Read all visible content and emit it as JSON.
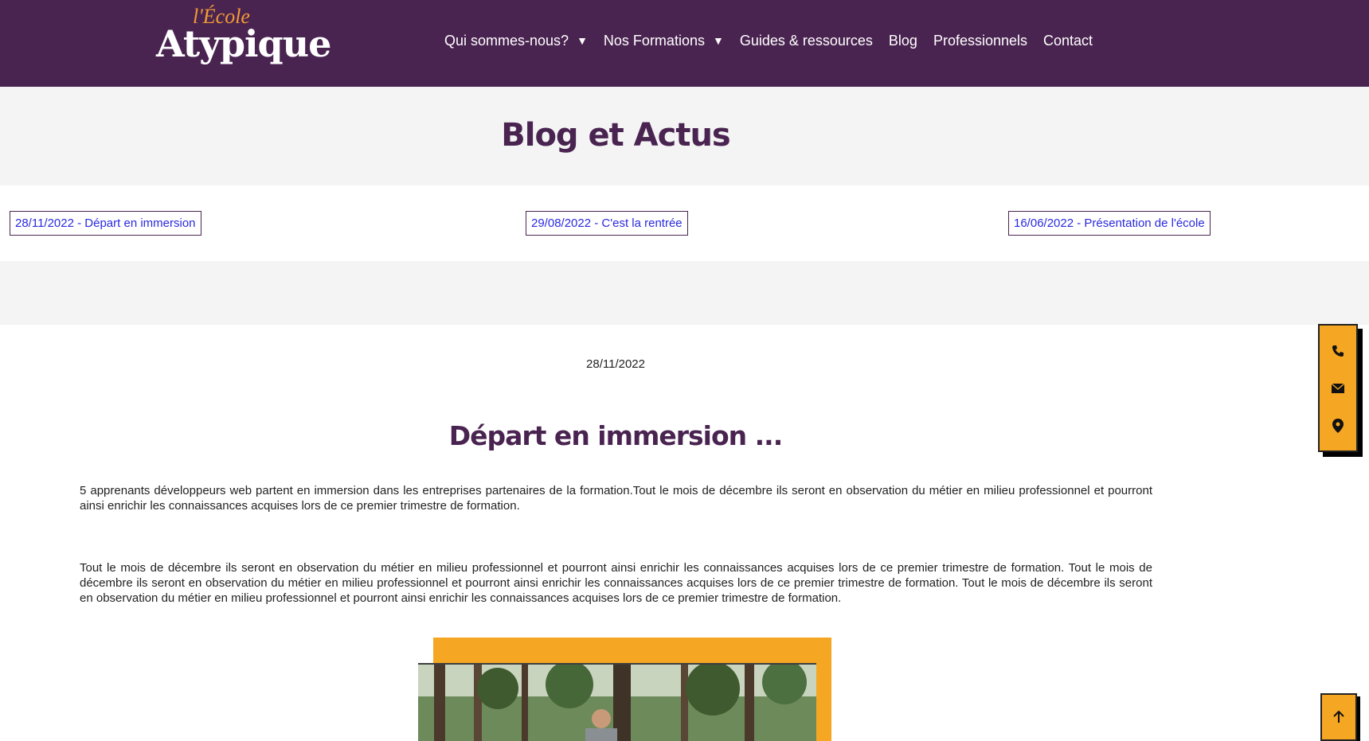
{
  "brand": {
    "logo_top": "l'École",
    "logo_main": "Atypique"
  },
  "nav": {
    "items": [
      {
        "label": "Qui sommes-nous?",
        "has_dropdown": true
      },
      {
        "label": "Nos Formations",
        "has_dropdown": true
      },
      {
        "label": "Guides & ressources",
        "has_dropdown": false
      },
      {
        "label": "Blog",
        "has_dropdown": false
      },
      {
        "label": "Professionnels",
        "has_dropdown": false
      },
      {
        "label": "Contact",
        "has_dropdown": false
      }
    ],
    "caret": "▼"
  },
  "page": {
    "title": "Blog et Actus"
  },
  "posts": [
    {
      "label": "28/11/2022 - Départ en immersion"
    },
    {
      "label": "29/08/2022 - C'est la rentrée"
    },
    {
      "label": "16/06/2022 - Présentation de l'école"
    }
  ],
  "article": {
    "date": "28/11/2022",
    "title": "Départ en immersion ...",
    "paragraph1": "5 apprenants développeurs web partent en immersion dans les entreprises partenaires de la formation.Tout le mois de décembre ils seront en observation du métier en milieu professionnel et pourront ainsi enrichir les connaissances acquises lors de ce premier trimestre de formation.",
    "paragraph2": "Tout le mois de décembre ils seront en observation du métier en milieu professionnel et pourront ainsi enrichir les connaissances acquises lors de ce premier trimestre de formation. Tout le mois de décembre ils seront en observation du métier en milieu professionnel et pourront ainsi enrichir les connaissances acquises lors de ce premier trimestre de formation. Tout le mois de décembre ils seront en observation du métier en milieu professionnel et pourront ainsi enrichir les connaissances acquises lors de ce premier trimestre de formation."
  },
  "widget": {
    "icons": [
      "phone-icon",
      "envelope-icon",
      "map-marker-icon"
    ],
    "to_top_icon": "arrow-up-icon"
  },
  "colors": {
    "header_bg": "#4a2451",
    "accent": "#f5a623",
    "link": "#2a2adf",
    "title": "#4a2451"
  }
}
